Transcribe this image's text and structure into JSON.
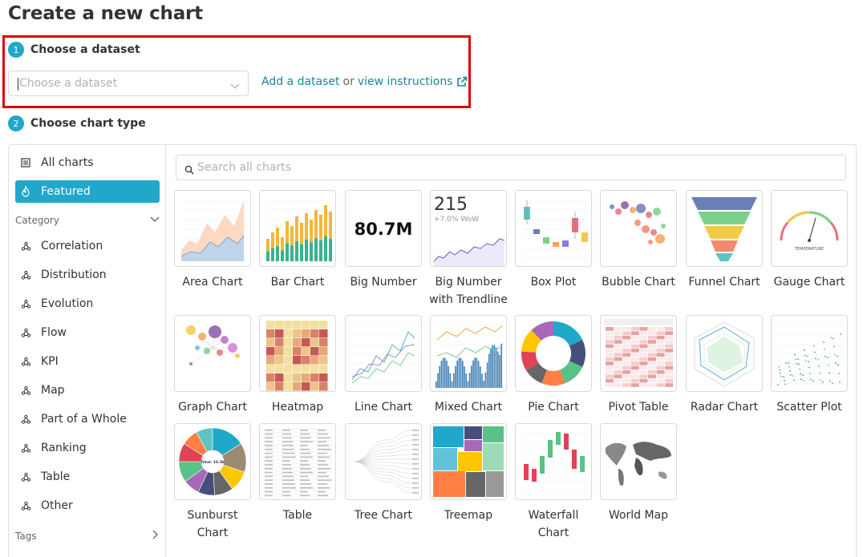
{
  "page_title": "Create a new chart",
  "step1": {
    "number": "1",
    "label": "Choose a dataset"
  },
  "step2": {
    "number": "2",
    "label": "Choose chart type"
  },
  "dataset": {
    "placeholder": "Choose a dataset",
    "add_link": "Add a dataset",
    "or_text": "or",
    "instructions_link": "view instructions",
    "trailing": "."
  },
  "sidebar": {
    "all_charts": "All charts",
    "featured": "Featured",
    "category_label": "Category",
    "categories": [
      "Correlation",
      "Distribution",
      "Evolution",
      "Flow",
      "KPI",
      "Map",
      "Part of a Whole",
      "Ranking",
      "Table",
      "Other"
    ],
    "tags_label": "Tags"
  },
  "search": {
    "placeholder": "Search all charts"
  },
  "charts": [
    [
      "Area Chart"
    ],
    [
      "Bar Chart"
    ],
    [
      "Big Number"
    ],
    [
      "Big Number",
      "with Trendline"
    ],
    [
      "Box Plot"
    ],
    [
      "Bubble Chart"
    ],
    [
      "Funnel Chart"
    ],
    [
      "Gauge Chart"
    ],
    [
      "Graph Chart"
    ],
    [
      "Heatmap"
    ],
    [
      "Line Chart"
    ],
    [
      "Mixed Chart"
    ],
    [
      "Pie Chart"
    ],
    [
      "Pivot Table"
    ],
    [
      "Radar Chart"
    ],
    [
      "Scatter Plot"
    ],
    [
      "Sunburst",
      "Chart"
    ],
    [
      "Table"
    ],
    [
      "Tree Chart"
    ],
    [
      "Treemap"
    ],
    [
      "Waterfall",
      "Chart"
    ],
    [
      "World Map"
    ]
  ],
  "thumb_text": {
    "big_number": "80.7M",
    "trend_value": "215",
    "trend_sub": "+7.0% WoW",
    "sunburst_center": "Total: 10.5k",
    "gauge_label": "TEMPERATURE"
  },
  "colors": {
    "accent": "#20a7c9",
    "link": "#1985a0",
    "highlight": "#e00000"
  }
}
